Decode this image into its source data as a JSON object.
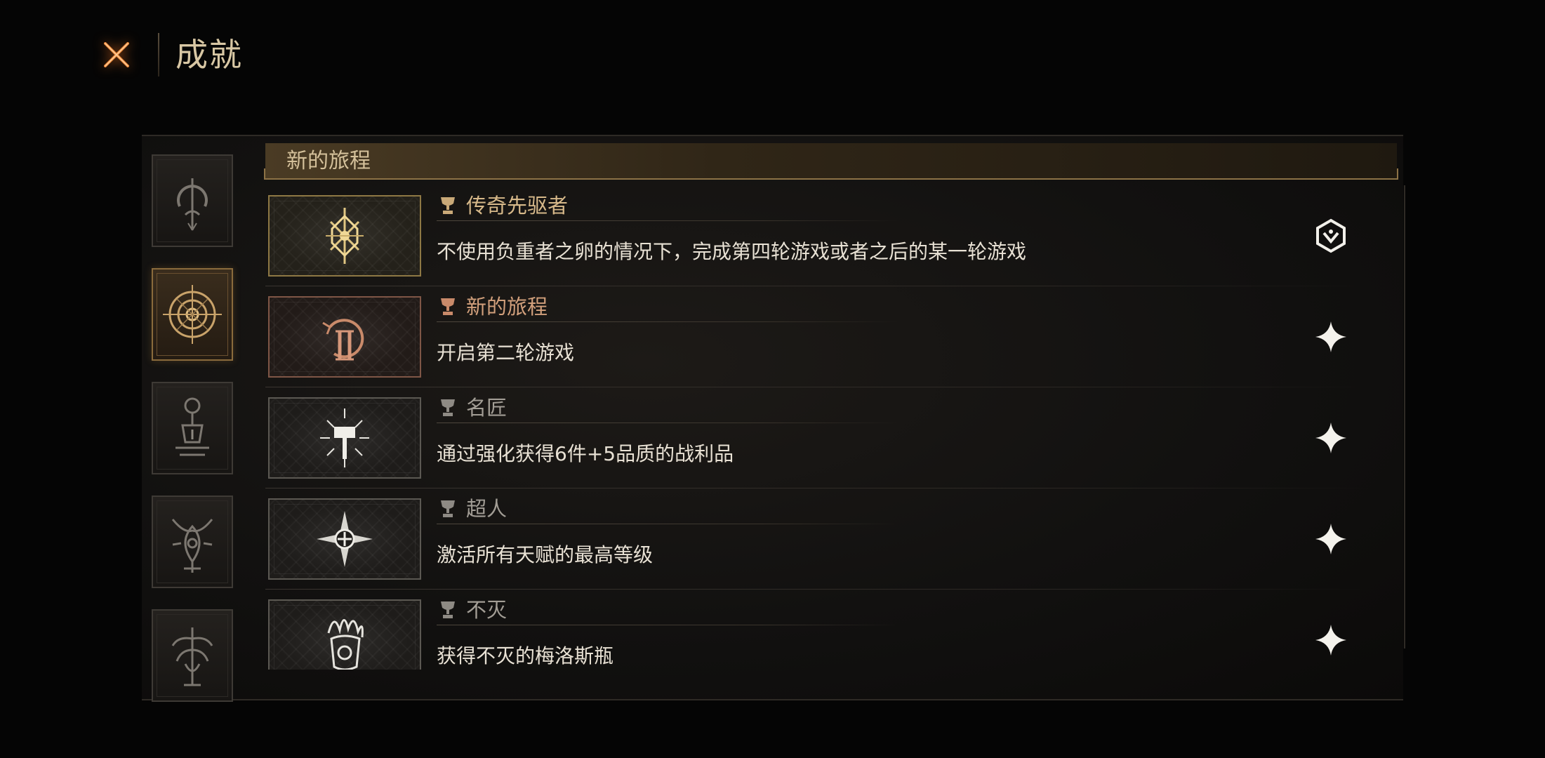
{
  "header": {
    "title": "成就",
    "close_icon": "close-x-icon"
  },
  "sidebar": {
    "categories": [
      {
        "icon": "arch-sigil-icon",
        "active": false
      },
      {
        "icon": "target-rune-icon",
        "active": true
      },
      {
        "icon": "lantern-rune-icon",
        "active": false
      },
      {
        "icon": "horned-crest-icon",
        "active": false
      },
      {
        "icon": "tree-crest-icon",
        "active": false
      }
    ]
  },
  "section": {
    "title": "新的旅程"
  },
  "achievements": [
    {
      "title": "传奇先驱者",
      "description": "不使用负重者之卵的情况下，完成第四轮游戏或者之后的某一轮游戏",
      "status_icon": "hex-emblem-icon",
      "badge_icon": "sunburst-rune-icon",
      "trophy_icon": "trophy-icon"
    },
    {
      "title": "新的旅程",
      "description": "开启第二轮游戏",
      "status_icon": "sparkle-icon",
      "badge_icon": "roman-two-rune-icon",
      "trophy_icon": "trophy-icon"
    },
    {
      "title": "名匠",
      "description": "通过强化获得6件+5品质的战利品",
      "status_icon": "sparkle-icon",
      "badge_icon": "radiant-hammer-icon",
      "trophy_icon": "trophy-icon"
    },
    {
      "title": "超人",
      "description": "激活所有天赋的最高等级",
      "status_icon": "sparkle-icon",
      "badge_icon": "compass-star-icon",
      "trophy_icon": "trophy-icon"
    },
    {
      "title": "不灭",
      "description": "获得不灭的梅洛斯瓶",
      "status_icon": "sparkle-icon",
      "badge_icon": "flame-flask-icon",
      "trophy_icon": "trophy-icon"
    }
  ],
  "colors": {
    "accent_gold": "#d4c09a",
    "title_completed": "#d7b98a",
    "title_copper": "#d2a07c",
    "title_locked": "#a29d95",
    "close_orange": "#e8792c"
  }
}
